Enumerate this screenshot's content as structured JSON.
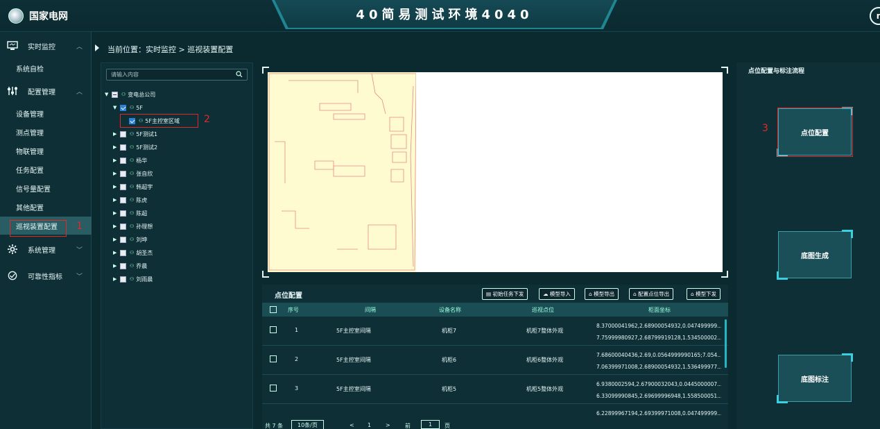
{
  "header": {
    "logo_text": "国家电网",
    "title": "40简易测试环境4040",
    "avatar_initial": "n"
  },
  "sidebar": {
    "groups": [
      {
        "label": "实时监控",
        "icon": "monitor-icon",
        "items": [
          "系统自检"
        ]
      },
      {
        "label": "配置管理",
        "icon": "sliders-icon",
        "items": [
          "设备管理",
          "测点管理",
          "物联管理",
          "任务配置",
          "信号量配置",
          "其他配置",
          "巡视装置配置"
        ]
      },
      {
        "label": "系统管理",
        "icon": "gear-icon",
        "items": []
      },
      {
        "label": "可靠性指标",
        "icon": "target-icon",
        "items": []
      }
    ],
    "active_item": "巡视装置配置"
  },
  "breadcrumb": {
    "text": "当前位置：实时监控 > 巡视装置配置"
  },
  "tree": {
    "search_placeholder": "请输入内容",
    "root": "变电总公司",
    "nodes": [
      "5F",
      "5F主控室区域",
      "5F测试1",
      "5F测试2",
      "杨华",
      "张自欣",
      "韩超宇",
      "陈虎",
      "陈超",
      "孙理想",
      "刘坤",
      "胡圣杰",
      "乔晨",
      "刘雨晨"
    ]
  },
  "annotations": [
    "1",
    "2",
    "3"
  ],
  "table": {
    "title": "点位配置",
    "buttons": [
      "初始任务下发",
      "模型导入",
      "模型导出",
      "配置点位导出",
      "模型下发"
    ],
    "columns": [
      "序号",
      "间隔",
      "设备名称",
      "巡视点位",
      "柜面坐标"
    ],
    "rows": [
      {
        "no": "1",
        "bay": "5F主控室间隔",
        "device": "机柜7",
        "point": "机柜7整体外观",
        "coord1": "8.37000041962,2.68900054932,0.047499999...",
        "coord2": "7.75999980927,2.68799919128,1.534500002..."
      },
      {
        "no": "2",
        "bay": "5F主控室间隔",
        "device": "机柜6",
        "point": "机柜6整体外观",
        "coord1": "7.68600040436,2.69,0.0564999990165;7.054...",
        "coord2": "7.06399971008,2.68900054932,1.536499977..."
      },
      {
        "no": "3",
        "bay": "5F主控室间隔",
        "device": "机柜5",
        "point": "机柜5整体外观",
        "coord1": "6.9380002594,2.67900032043,0.0445000007...",
        "coord2": "6.33099990845,2.69699996948,1.558500051..."
      },
      {
        "no": "",
        "bay": "",
        "device": "",
        "point": "",
        "coord1": "6.22899967194,2.69399971008,0.047499999...",
        "coord2": ""
      }
    ],
    "pager": {
      "total": "共 7 条",
      "page_size": "10条/页",
      "prev": "<",
      "page": "1",
      "next": ">",
      "goto": "前往",
      "goto_value": "1",
      "goto_suffix": "页"
    }
  },
  "right_panel": {
    "title": "点位配置与标注流程",
    "buttons": [
      "点位配置",
      "底图生成",
      "底图标注"
    ]
  }
}
